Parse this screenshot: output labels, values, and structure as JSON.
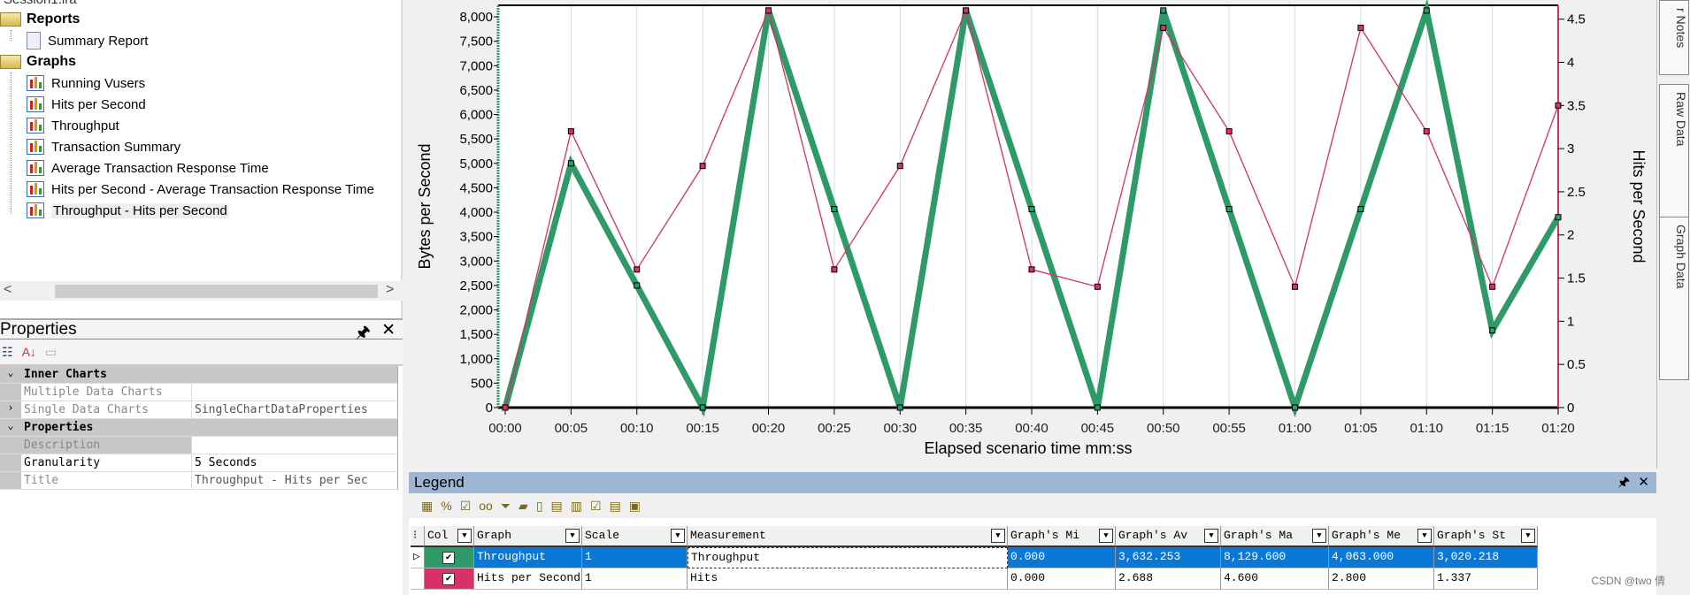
{
  "tree": {
    "session": "Session1.lra",
    "reports_label": "Reports",
    "report_items": [
      "Summary Report"
    ],
    "graphs_label": "Graphs",
    "graph_items": [
      "Running Vusers",
      "Hits per Second",
      "Throughput",
      "Transaction Summary",
      "Average Transaction Response Time",
      "Hits per Second - Average Transaction Response Time",
      "Throughput - Hits per Second"
    ],
    "selected": "Throughput - Hits per Second"
  },
  "properties": {
    "title": "Properties",
    "rows": [
      {
        "type": "category",
        "key": "Inner Charts"
      },
      {
        "type": "row",
        "key": "Multiple Data Charts",
        "value": ""
      },
      {
        "type": "row",
        "key": "Single Data Charts",
        "value": "SingleChartDataProperties",
        "expandable": true
      },
      {
        "type": "category",
        "key": "Properties"
      },
      {
        "type": "row",
        "key": "Description",
        "value": ""
      },
      {
        "type": "row",
        "key": "Granularity",
        "value": "5 Seconds",
        "bold": true
      },
      {
        "type": "row",
        "key": "Title",
        "value": "Throughput - Hits per Sec"
      }
    ]
  },
  "side_tabs": [
    "r Notes",
    "Raw Data",
    "Graph Data"
  ],
  "chart_data": {
    "type": "line",
    "x": [
      "00:00",
      "00:05",
      "00:10",
      "00:15",
      "00:20",
      "00:25",
      "00:30",
      "00:35",
      "00:40",
      "00:45",
      "00:50",
      "00:55",
      "01:00",
      "01:05",
      "01:10",
      "01:15",
      "01:20"
    ],
    "xlabel": "Elapsed scenario time mm:ss",
    "ylabel": "Bytes per Second",
    "y2label": "Hits per Second",
    "ylim": [
      0,
      8200
    ],
    "y2lim": [
      0,
      4.64
    ],
    "yticks": [
      0,
      500,
      1000,
      1500,
      2000,
      2500,
      3000,
      3500,
      4000,
      4500,
      5000,
      5500,
      6000,
      6500,
      7000,
      7500,
      8000
    ],
    "y2ticks": [
      0,
      0.5,
      1,
      1.5,
      2,
      2.5,
      3,
      3.5,
      4,
      4.5
    ],
    "grid": "vertical",
    "series": [
      {
        "name": "Throughput",
        "axis": "left",
        "color": "#2e9a68",
        "values": [
          0,
          5000,
          2500,
          0,
          8129.6,
          4063,
          0,
          8129.6,
          4063,
          0,
          8129.6,
          4063,
          0,
          4063,
          8129.6,
          1580,
          3898
        ]
      },
      {
        "name": "Hits per Second",
        "axis": "right",
        "color": "#d83068",
        "values": [
          0,
          3.2,
          1.6,
          2.8,
          4.6,
          1.6,
          2.8,
          4.6,
          1.6,
          1.4,
          4.4,
          3.2,
          1.4,
          4.4,
          3.2,
          1.4,
          3.5
        ]
      }
    ]
  },
  "legend": {
    "title": "Legend",
    "columns": [
      "Col",
      "Graph",
      "Scale",
      "Measurement",
      "Graph's Mi",
      "Graph's Av",
      "Graph's Ma",
      "Graph's Me",
      "Graph's St"
    ],
    "rows": [
      {
        "color": "#2e9a68",
        "checked": true,
        "cells": [
          "Throughput",
          "1",
          "Throughput",
          "0.000",
          "3,632.253",
          "8,129.600",
          "4,063.000",
          "3,020.218"
        ],
        "selected": true
      },
      {
        "color": "#d83068",
        "checked": true,
        "cells": [
          "Hits per Second",
          "1",
          "Hits",
          "0.000",
          "2.688",
          "4.600",
          "2.800",
          "1.337"
        ],
        "selected": false
      }
    ]
  },
  "watermark": "CSDN @two 倩"
}
